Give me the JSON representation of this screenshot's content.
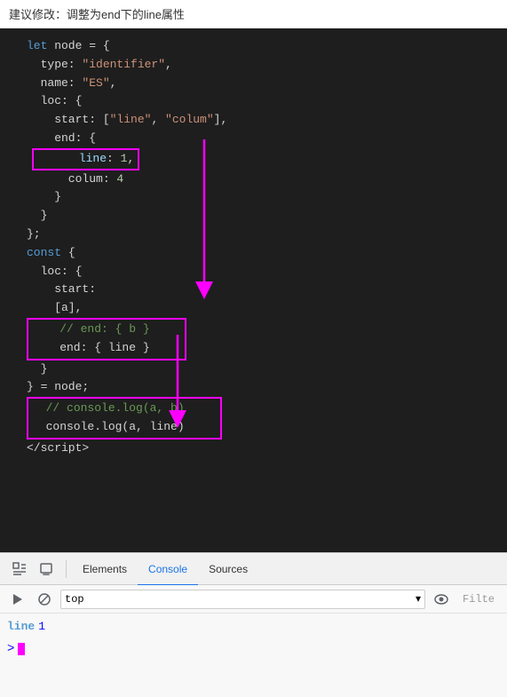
{
  "annotation": {
    "text": "建议修改：调整为end下的line属性"
  },
  "code": {
    "lines": [
      {
        "type": "normal",
        "content": "let node = {"
      },
      {
        "type": "normal",
        "content": "  type: \"identifier\","
      },
      {
        "type": "normal",
        "content": "  name: \"ES\","
      },
      {
        "type": "normal",
        "content": "  loc: {"
      },
      {
        "type": "normal",
        "content": "    start: [\"line\", \"colum\"],"
      },
      {
        "type": "normal",
        "content": "    end: {"
      },
      {
        "type": "highlight1",
        "content": "      line: 1,"
      },
      {
        "type": "normal",
        "content": "      colum: 4"
      },
      {
        "type": "normal",
        "content": "    }"
      },
      {
        "type": "normal",
        "content": "  }"
      },
      {
        "type": "normal",
        "content": "};"
      },
      {
        "type": "normal",
        "content": "const {"
      },
      {
        "type": "normal",
        "content": "  loc: {"
      },
      {
        "type": "normal",
        "content": "    start:"
      },
      {
        "type": "normal",
        "content": "    [a],"
      },
      {
        "type": "highlight2a",
        "content": "    // end: { b }"
      },
      {
        "type": "highlight2b",
        "content": "    end: { line }"
      },
      {
        "type": "normal",
        "content": "  }"
      },
      {
        "type": "normal",
        "content": "} = node;"
      },
      {
        "type": "highlight3a",
        "content": "  // console.log(a, b)"
      },
      {
        "type": "highlight3b",
        "content": "  console.log(a, line)"
      }
    ]
  },
  "devtools": {
    "icons": {
      "inspector": "⬚",
      "device": "⬜",
      "play": "▶",
      "block": "⊘"
    },
    "tabs": [
      {
        "label": "Elements",
        "active": false
      },
      {
        "label": "Console",
        "active": true
      },
      {
        "label": "Sources",
        "active": false
      }
    ],
    "console": {
      "dropdown_value": "top",
      "filter_placeholder": "Filte"
    },
    "output": {
      "line_label": "line",
      "line_value": "1"
    },
    "prompt_symbol": ">"
  }
}
